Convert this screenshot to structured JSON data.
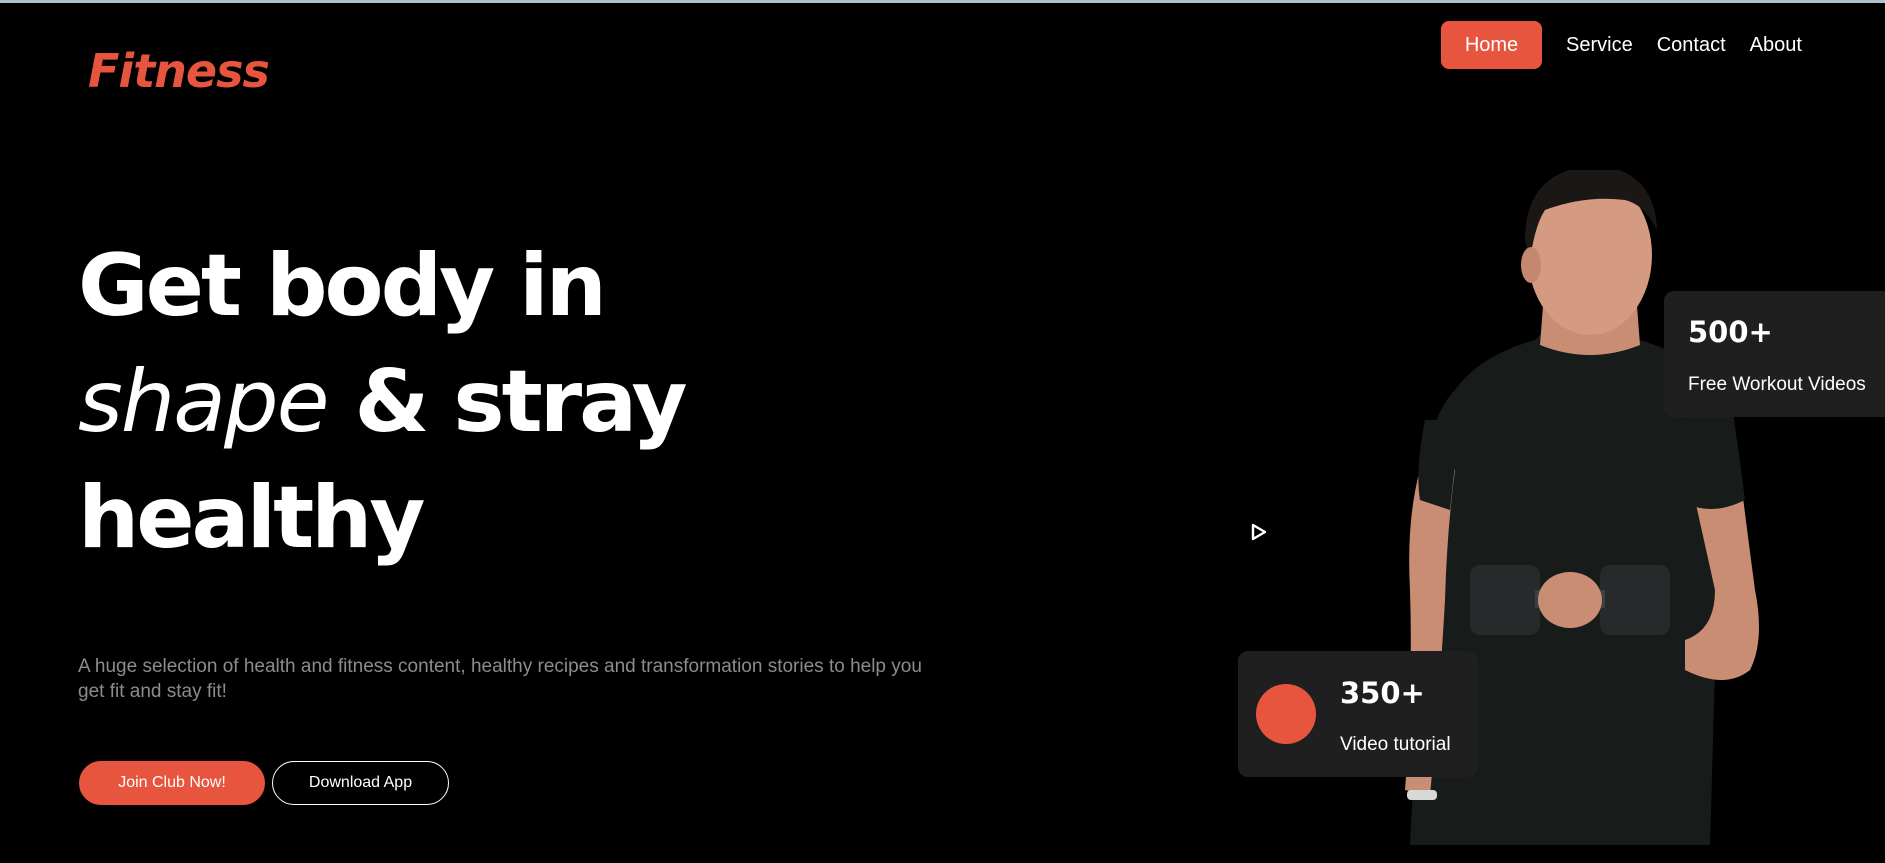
{
  "brand": {
    "logo_text": "Fitness",
    "accent_color": "#e8553f"
  },
  "nav": {
    "items": [
      {
        "label": "Home",
        "active": true
      },
      {
        "label": "Service",
        "active": false
      },
      {
        "label": "Contact",
        "active": false
      },
      {
        "label": "About",
        "active": false
      }
    ]
  },
  "hero": {
    "title_line1": "Get body in",
    "title_line2_light": "shape",
    "title_line2_bold": " & stray",
    "title_line3": "healthy",
    "subtitle": "A huge selection of health and fitness content, healthy recipes and transformation stories to help you get fit and stay fit!",
    "join_label": "Join Club Now!",
    "download_label": "Download App"
  },
  "stats": [
    {
      "number": "500+",
      "label": "Free Workout Videos"
    },
    {
      "number": "350+",
      "label": "Video tutorial"
    }
  ],
  "media": {
    "play_icon": "play-icon",
    "person_image": "man-with-dumbbell"
  }
}
